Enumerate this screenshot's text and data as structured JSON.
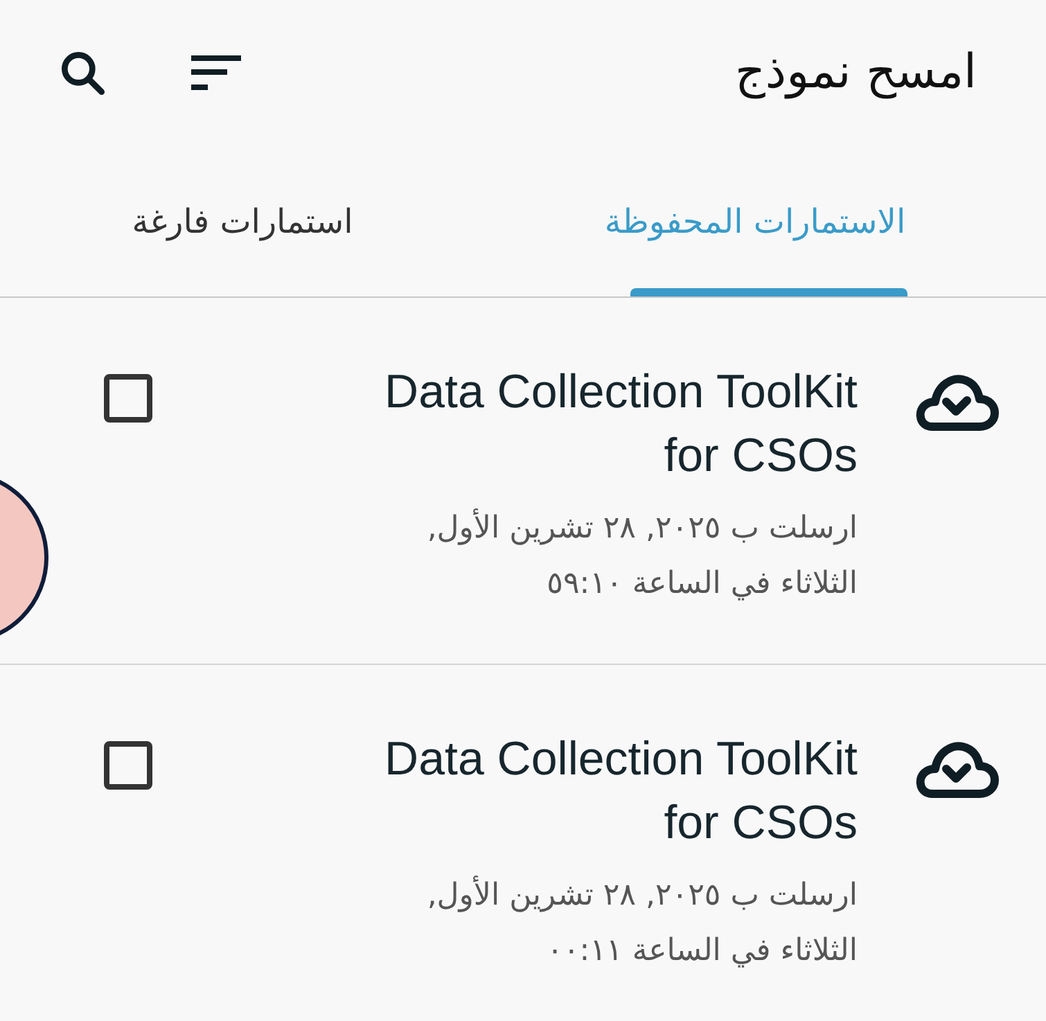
{
  "app_bar": {
    "title": "امسح نموذج"
  },
  "tabs": [
    {
      "label": "الاستمارات المحفوظة",
      "selected": true
    },
    {
      "label": "استمارات فارغة",
      "selected": false
    }
  ],
  "forms": [
    {
      "title": "Data Collection ToolKit for CSOs",
      "subtitle": "ارسلت ب ٢٠٢٥, ٢٨ تشرين الأول, الثلاثاء في الساعة ٥٩:١٠",
      "checked": false
    },
    {
      "title": "Data Collection ToolKit for CSOs",
      "subtitle": "ارسلت ب ٢٠٢٥, ٢٨ تشرين الأول, الثلاثاء في الساعة ٠٠:١١",
      "checked": false
    }
  ]
}
